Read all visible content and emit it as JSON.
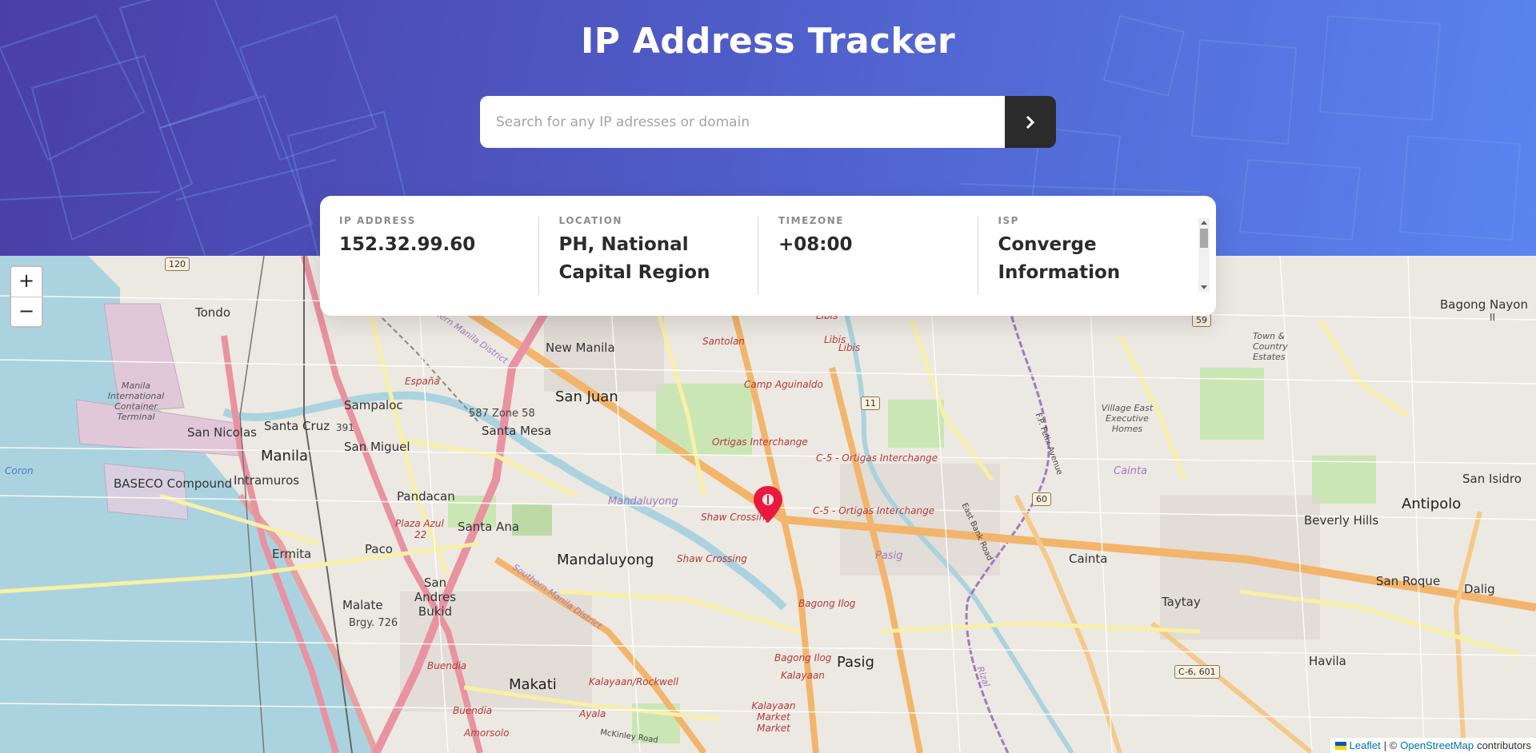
{
  "header": {
    "title": "IP Address Tracker"
  },
  "search": {
    "placeholder": "Search for any IP adresses or domain",
    "value": ""
  },
  "info": {
    "ip_label": "IP ADDRESS",
    "ip_value": "152.32.99.60",
    "location_label": "LOCATION",
    "location_value": "PH, National Capital Region",
    "timezone_label": "TIMEZONE",
    "timezone_value": "+08:00",
    "isp_label": "ISP",
    "isp_value": "Converge Information"
  },
  "map": {
    "zoom_in": "+",
    "zoom_out": "−",
    "marker_icon": "map-pin-icon",
    "attribution": {
      "leaflet": "Leaflet",
      "separator": "| ©",
      "osm": "OpenStreetMap",
      "suffix": "contributors"
    },
    "labels": {
      "tondo": "Tondo",
      "new_manila": "New Manila",
      "santolan": "Santolan",
      "libis": "Libis",
      "libis2": "Libis",
      "libis3": "Libis",
      "bagong_nayon": "Bagong Nayon",
      "ii": "II",
      "espana": "España",
      "san_juan": "San Juan",
      "camp_aguinaldo": "Camp Aguinaldo",
      "manila_intl": "Manila International Container Terminal",
      "sampaloc": "Sampaloc",
      "zone58": "587 Zone 58",
      "santa_mesa": "Santa Mesa",
      "san_nicolas": "San Nicolas",
      "santa_cruz": "Santa Cruz",
      "n391": "391",
      "manila": "Manila",
      "san_miguel": "San Miguel",
      "ortigas_interchange": "Ortigas Interchange",
      "c5_ortigas_1": "C-5 - Ortigas Interchange",
      "c5_ortigas_2": "C-5 - Ortigas Interchange",
      "village_east": "Village East Executive Homes",
      "town_country": "Town & Country Estates",
      "cainta_it": "Cainta",
      "intramuros": "Intramuros",
      "baseco": "BASECO Compound",
      "coron": "Coron",
      "pandacan": "Pandacan",
      "mandaluyong_it": "Mandaluyong",
      "shaw_crossing_1": "Shaw Crossing",
      "san_isidro": "San Isidro",
      "antipolo": "Antipolo",
      "beverly_hills": "Beverly Hills",
      "plaza_azul": "Plaza Azul",
      "n22": "22",
      "santa_ana": "Santa Ana",
      "ermita": "Ermita",
      "paco": "Paco",
      "mandaluyong": "Mandaluyong",
      "shaw_crossing_2": "Shaw Crossing",
      "pasig_it": "Pasig",
      "cainta": "Cainta",
      "san_roque": "San Roque",
      "dalig": "Dalig",
      "san_andres": "San Andres Bukid",
      "taytay": "Taytay",
      "malate": "Malate",
      "brgy726": "Brgy. 726",
      "bagong_ilog_1": "Bagong Ilog",
      "bagong_ilog_2": "Bagong Ilog",
      "pasig": "Pasig",
      "havila": "Havila",
      "buendia_1": "Buendia",
      "makati": "Makati",
      "kalayaan_rockwell": "Kalayaan/Rockwell",
      "kalayaan": "Kalayaan",
      "kalayaan_market": "Kalayaan Market Market",
      "buendia_2": "Buendia",
      "ayala": "Ayala",
      "amorsolo": "Amorsolo",
      "mckinley": "McKinley Road",
      "fp_felix": "F.P. Felix Avenue",
      "east_bank": "East Bank Road",
      "rizal": "Rizal",
      "southern_manila": "Southern Manila District",
      "eastern_manila": "Eastern Manila District",
      "shield_120": "120",
      "shield_59": "59",
      "shield_11": "11",
      "shield_60": "60",
      "shield_c6": "C-6, 601"
    }
  }
}
